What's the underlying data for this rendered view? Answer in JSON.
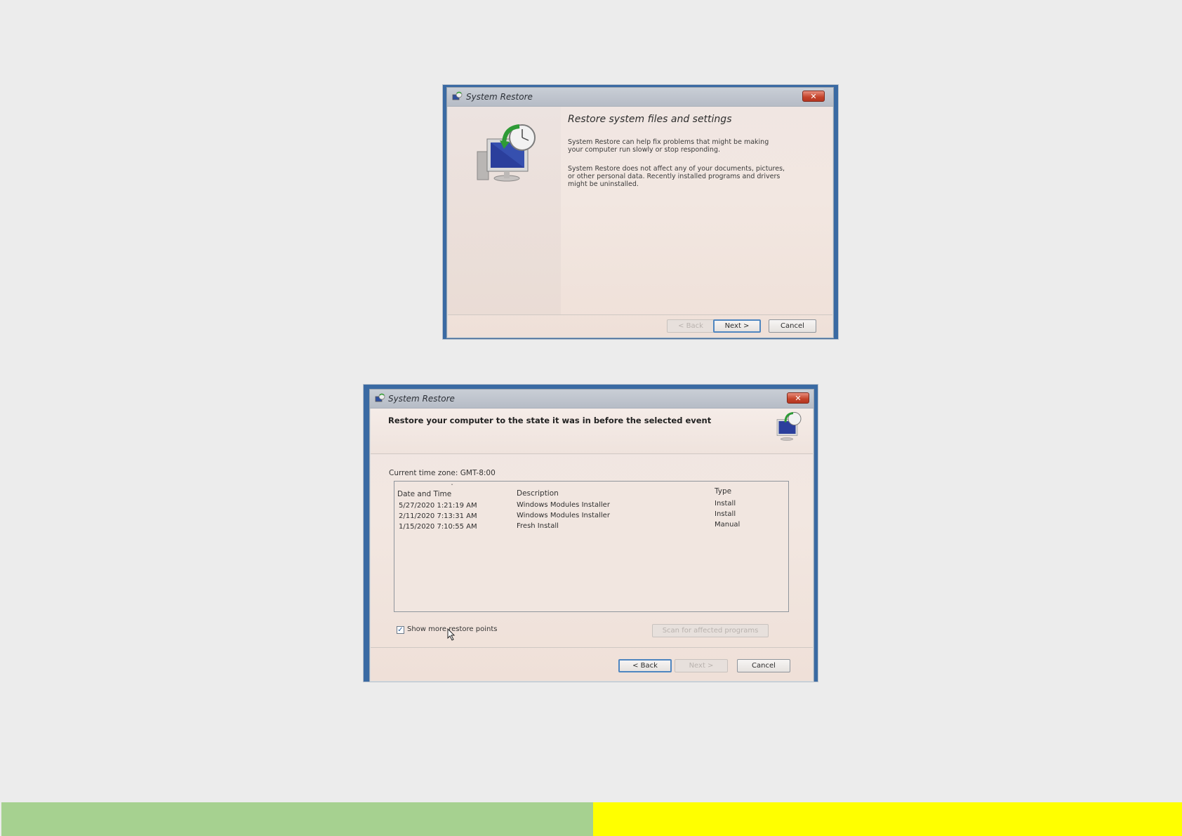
{
  "dialog1": {
    "window_title": "System Restore",
    "close_symbol": "✕",
    "heading": "Restore system files and settings",
    "paragraph1": "System Restore can help fix problems that might be making your computer run slowly or stop responding.",
    "paragraph2": "System Restore does not affect any of your documents, pictures, or other personal data. Recently installed programs and drivers might be uninstalled.",
    "buttons": {
      "back": "< Back",
      "next": "Next >",
      "cancel": "Cancel"
    },
    "icon": "system-restore-icon"
  },
  "dialog2": {
    "window_title": "System Restore",
    "close_symbol": "✕",
    "heading": "Restore your computer to the state it was in before the selected event",
    "timezone_label": "Current time zone: GMT-8:00",
    "columns": [
      "Date and Time",
      "Description",
      "Type"
    ],
    "rows": [
      {
        "date": "5/27/2020 1:21:19 AM",
        "description": "Windows Modules Installer",
        "type": "Install"
      },
      {
        "date": "2/11/2020 7:13:31 AM",
        "description": "Windows Modules Installer",
        "type": "Install"
      },
      {
        "date": "1/15/2020 7:10:55 AM",
        "description": "Fresh Install",
        "type": "Manual"
      }
    ],
    "show_more_label": "Show more restore points",
    "show_more_checked": true,
    "check_mark": "✓",
    "scan_button": "Scan for affected programs",
    "buttons": {
      "back": "< Back",
      "next": "Next >",
      "cancel": "Cancel"
    },
    "icon": "system-restore-icon"
  },
  "colors": {
    "green_bar": "#a6d190",
    "yellow_bar": "#ffff00",
    "focus_blue": "#4f86c0"
  }
}
